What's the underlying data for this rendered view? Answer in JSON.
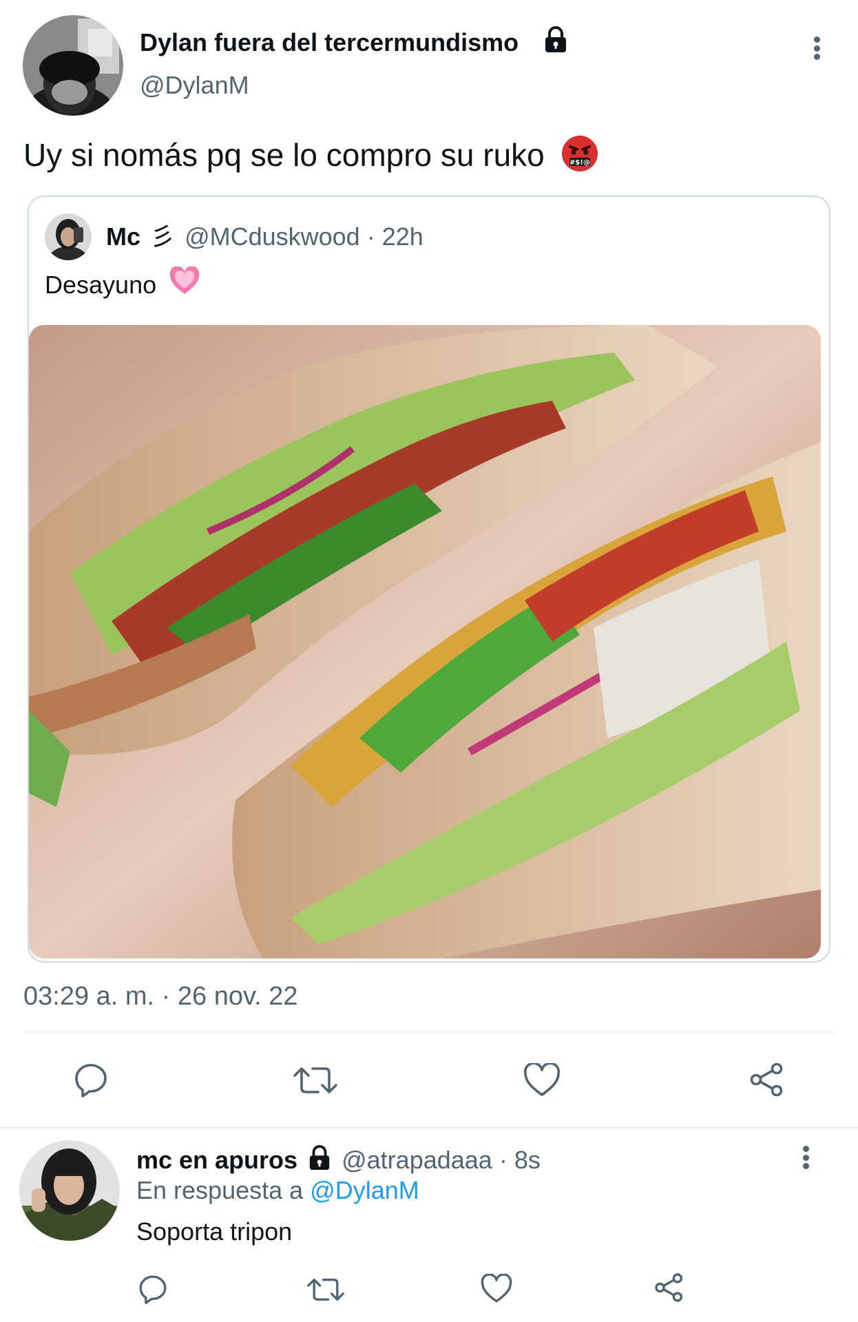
{
  "main_tweet": {
    "display_name": "Dylan fuera del tercermundismo",
    "handle": "@DylanM",
    "text": "Uy si nomás pq se lo compro su ruko",
    "emoji": "🤬",
    "timestamp": "03:29 a. m. · 26 nov. 22"
  },
  "quoted_tweet": {
    "display_name": "Mc",
    "name_emoji": "彡",
    "handle": "@MCduskwood",
    "time": "· 22h",
    "text": "Desayuno",
    "emoji": "💗"
  },
  "reply": {
    "display_name": "mc en apuros",
    "handle": "@atrapadaaa",
    "time": "· 8s",
    "reply_prefix": "En respuesta a",
    "reply_to": "@DylanM",
    "text": "Soporta tripon"
  },
  "actions": [
    "reply-icon",
    "retweet-icon",
    "like-icon",
    "share-icon"
  ],
  "colors": {
    "accent": "#1d9bf0",
    "secondary_text": "#536471",
    "border": "#cfd9de",
    "divider": "#eff3f4"
  }
}
